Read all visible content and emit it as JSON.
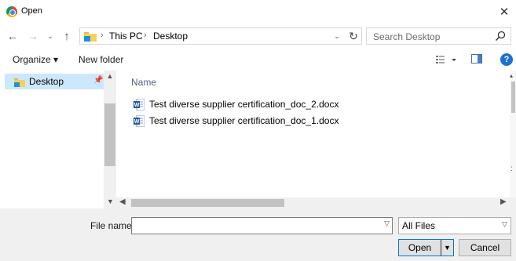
{
  "window": {
    "title": "Open",
    "app_icon": "chrome-icon",
    "close_glyph": "✕"
  },
  "nav": {
    "back_glyph": "←",
    "forward_glyph": "→",
    "recent_glyph": "⌄",
    "up_glyph": "↑",
    "breadcrumb": [
      "This PC",
      "Desktop"
    ],
    "separator": "›",
    "dropdown_glyph": "⌄",
    "refresh_glyph": "↻"
  },
  "search": {
    "placeholder": "Search Desktop"
  },
  "toolbar": {
    "organize_label": "Organize ▾",
    "new_folder_label": "New folder",
    "help_label": "?"
  },
  "sidebar": {
    "items": [
      {
        "label": "Desktop",
        "icon": "folder-icon",
        "pinned": true,
        "selected": true
      }
    ]
  },
  "files": {
    "column_header": "Name",
    "items": [
      {
        "name": "Test diverse supplier certification_doc_2.docx",
        "icon": "word-doc-icon"
      },
      {
        "name": "Test diverse supplier certification_doc_1.docx",
        "icon": "word-doc-icon"
      }
    ]
  },
  "bottom": {
    "file_name_label": "File name:",
    "file_name_value": "",
    "filter_value": "All Files",
    "open_label": "Open",
    "cancel_label": "Cancel"
  },
  "colors": {
    "accent": "#0078d7",
    "selection": "#cce8ff",
    "header_text": "#4c607a",
    "footer_bg": "#f0f0f0"
  }
}
